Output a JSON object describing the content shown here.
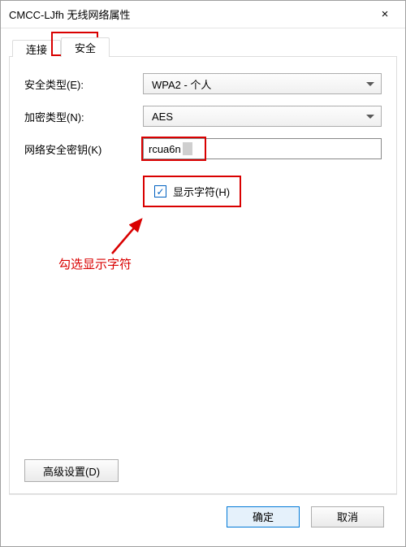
{
  "window": {
    "title": "CMCC-LJfh 无线网络属性",
    "close_label": "×"
  },
  "tabs": {
    "connection": "连接",
    "security": "安全"
  },
  "form": {
    "security_type_label": "安全类型(E):",
    "security_type_value": "WPA2 - 个人",
    "encryption_type_label": "加密类型(N):",
    "encryption_type_value": "AES",
    "network_key_label": "网络安全密钥(K)",
    "network_key_value": "rcua6n",
    "show_chars_label": "显示字符(H)",
    "show_chars_checked": true
  },
  "annotation": {
    "text": "勾选显示字符"
  },
  "buttons": {
    "advanced": "高级设置(D)",
    "ok": "确定",
    "cancel": "取消"
  },
  "colors": {
    "highlight": "#d90000",
    "accent": "#0078d7"
  }
}
